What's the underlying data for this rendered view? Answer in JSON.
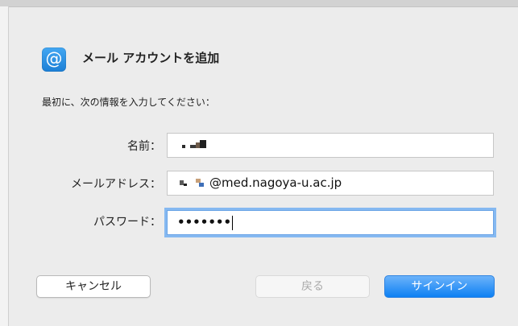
{
  "dialog": {
    "title": "メール アカウントを追加",
    "icon": "at-sign-icon",
    "instruction": "最初に、次の情報を入力してください："
  },
  "fields": {
    "name": {
      "label": "名前："
    },
    "email": {
      "label": "メールアドレス：",
      "value_suffix": "@med.nagoya-u.ac.jp"
    },
    "password": {
      "label": "パスワード：",
      "value_masked": "•••••••"
    }
  },
  "buttons": {
    "cancel": "キャンセル",
    "back": "戻る",
    "signin": "サインイン"
  },
  "colors": {
    "accent": "#1c7fd6",
    "focus_ring": "#86b9f1",
    "primary_button": "#0d80f3"
  }
}
